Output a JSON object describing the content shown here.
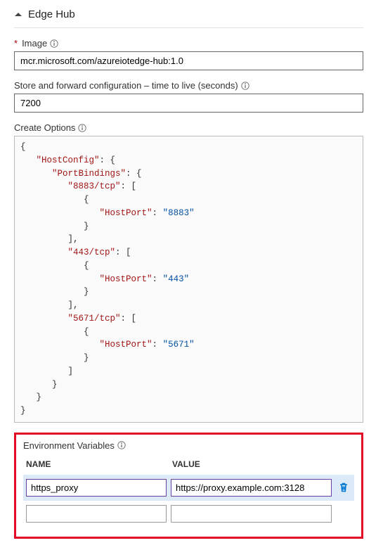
{
  "header": {
    "title": "Edge Hub"
  },
  "image": {
    "label": "Image",
    "required": "*",
    "value": "mcr.microsoft.com/azureiotedge-hub:1.0"
  },
  "ttl": {
    "label": "Store and forward configuration – time to live (seconds)",
    "value": "7200"
  },
  "createOptions": {
    "label": "Create Options",
    "json": {
      "open": "{",
      "close": "}",
      "hostConfig": {
        "key": "\"HostConfig\"",
        "portBindings": {
          "key": "\"PortBindings\"",
          "ports": [
            {
              "portKey": "\"8883/tcp\"",
              "hostPortKey": "\"HostPort\"",
              "hostPortVal": "\"8883\""
            },
            {
              "portKey": "\"443/tcp\"",
              "hostPortKey": "\"HostPort\"",
              "hostPortVal": "\"443\""
            },
            {
              "portKey": "\"5671/tcp\"",
              "hostPortKey": "\"HostPort\"",
              "hostPortVal": "\"5671\""
            }
          ]
        }
      }
    }
  },
  "envVars": {
    "label": "Environment Variables",
    "headers": {
      "name": "NAME",
      "value": "VALUE"
    },
    "rows": [
      {
        "name": "https_proxy",
        "value": "https://proxy.example.com:3128",
        "selected": true
      },
      {
        "name": "",
        "value": "",
        "selected": false
      }
    ]
  }
}
